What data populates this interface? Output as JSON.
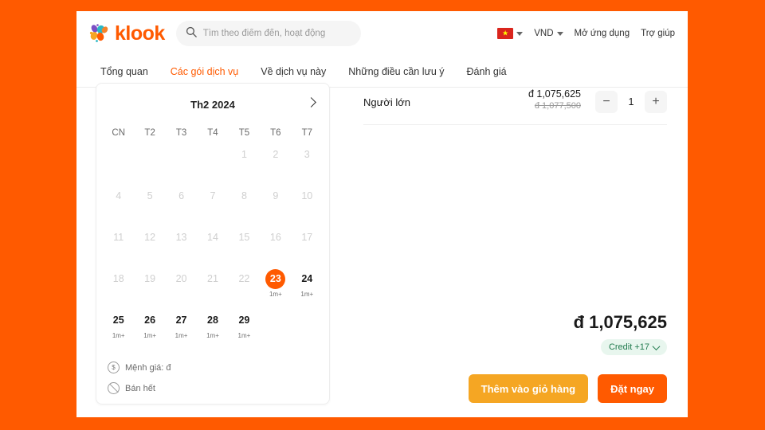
{
  "theme": {
    "page_background": "#FF5A00",
    "brand_orange": "#FF5A00",
    "cart_amber": "#F5A623",
    "credit_green_bg": "#E8F6EE",
    "credit_green_text": "#1F7A4D"
  },
  "header": {
    "logo_text": "klook",
    "logo_icon": "klook-petals-logo",
    "search": {
      "icon": "search-icon",
      "placeholder": "Tìm theo điểm đến, hoạt động",
      "value": ""
    },
    "locale": {
      "flag_icon": "vietnam-flag-icon",
      "flag_star": "★",
      "caret_icon": "chevron-down-icon"
    },
    "currency": {
      "label": "VND",
      "caret_icon": "chevron-down-icon"
    },
    "links": [
      {
        "label": "Mở ứng dụng",
        "name": "open-app-link"
      },
      {
        "label": "Trợ giúp",
        "name": "help-link"
      }
    ]
  },
  "tabs": [
    {
      "label": "Tổng quan",
      "name": "tab-overview",
      "active": false
    },
    {
      "label": "Các gói dịch vụ",
      "name": "tab-packages",
      "active": true
    },
    {
      "label": "Về dịch vụ này",
      "name": "tab-about",
      "active": false
    },
    {
      "label": "Những điều cần lưu ý",
      "name": "tab-notes",
      "active": false
    },
    {
      "label": "Đánh giá",
      "name": "tab-reviews",
      "active": false
    }
  ],
  "calendar": {
    "title": "Th2 2024",
    "next_icon": "chevron-right-icon",
    "weekdays": [
      "CN",
      "T2",
      "T3",
      "T4",
      "T5",
      "T6",
      "T7"
    ],
    "weeks": [
      [
        {
          "day": "",
          "state": "empty",
          "sub": ""
        },
        {
          "day": "",
          "state": "empty",
          "sub": ""
        },
        {
          "day": "",
          "state": "empty",
          "sub": ""
        },
        {
          "day": "",
          "state": "empty",
          "sub": ""
        },
        {
          "day": "1",
          "state": "disabled",
          "sub": ""
        },
        {
          "day": "2",
          "state": "disabled",
          "sub": ""
        },
        {
          "day": "3",
          "state": "disabled",
          "sub": ""
        }
      ],
      [
        {
          "day": "4",
          "state": "disabled",
          "sub": ""
        },
        {
          "day": "5",
          "state": "disabled",
          "sub": ""
        },
        {
          "day": "6",
          "state": "disabled",
          "sub": ""
        },
        {
          "day": "7",
          "state": "disabled",
          "sub": ""
        },
        {
          "day": "8",
          "state": "disabled",
          "sub": ""
        },
        {
          "day": "9",
          "state": "disabled",
          "sub": ""
        },
        {
          "day": "10",
          "state": "disabled",
          "sub": ""
        }
      ],
      [
        {
          "day": "11",
          "state": "disabled",
          "sub": ""
        },
        {
          "day": "12",
          "state": "disabled",
          "sub": ""
        },
        {
          "day": "13",
          "state": "disabled",
          "sub": ""
        },
        {
          "day": "14",
          "state": "disabled",
          "sub": ""
        },
        {
          "day": "15",
          "state": "disabled",
          "sub": ""
        },
        {
          "day": "16",
          "state": "disabled",
          "sub": ""
        },
        {
          "day": "17",
          "state": "disabled",
          "sub": ""
        }
      ],
      [
        {
          "day": "18",
          "state": "disabled",
          "sub": ""
        },
        {
          "day": "19",
          "state": "disabled",
          "sub": ""
        },
        {
          "day": "20",
          "state": "disabled",
          "sub": ""
        },
        {
          "day": "21",
          "state": "disabled",
          "sub": ""
        },
        {
          "day": "22",
          "state": "disabled",
          "sub": ""
        },
        {
          "day": "23",
          "state": "selected",
          "sub": "1m+"
        },
        {
          "day": "24",
          "state": "available",
          "sub": "1m+"
        }
      ],
      [
        {
          "day": "25",
          "state": "available",
          "sub": "1m+"
        },
        {
          "day": "26",
          "state": "available",
          "sub": "1m+"
        },
        {
          "day": "27",
          "state": "available",
          "sub": "1m+"
        },
        {
          "day": "28",
          "state": "available",
          "sub": "1m+"
        },
        {
          "day": "29",
          "state": "available",
          "sub": "1m+"
        },
        {
          "day": "",
          "state": "empty",
          "sub": ""
        },
        {
          "day": "",
          "state": "empty",
          "sub": ""
        }
      ]
    ],
    "legend": [
      {
        "icon": "dollar-circle-icon",
        "glyph": "$",
        "label": "Mệnh giá: đ"
      },
      {
        "icon": "sold-out-icon",
        "glyph": "",
        "label": "Bán hết"
      }
    ]
  },
  "booking": {
    "pax": {
      "label": "Người lớn",
      "price": "đ 1,075,625",
      "price_original": "đ 1,077,500",
      "quantity": "1",
      "minus_icon": "minus-icon",
      "plus_icon": "plus-icon"
    },
    "total": {
      "price": "đ 1,075,625",
      "credit_label": "Credit +17",
      "credit_chevron_icon": "chevron-down-icon"
    },
    "buttons": {
      "add_to_cart": "Thêm vào giỏ hàng",
      "book_now": "Đặt ngay"
    }
  }
}
